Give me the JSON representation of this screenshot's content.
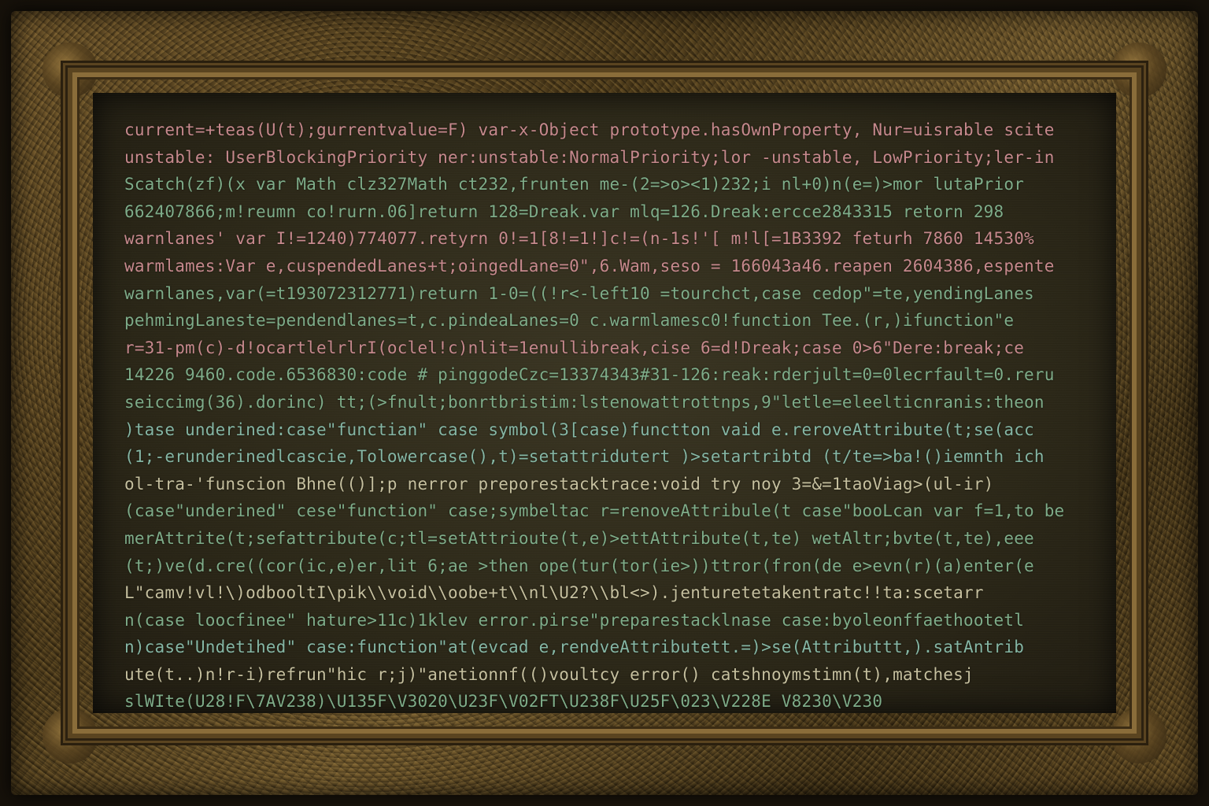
{
  "painting": {
    "lines": [
      {
        "text": "current=+teas(U(t);gurrentvalue=F) var-x-Object prototype.hasOwnProperty, Nur=uisrable scite",
        "color": "pink"
      },
      {
        "text": "unstable: UserBlockingPriority ner:unstable:NormalPriority;lor -unstable, LowPriority;ler-in",
        "color": "pink"
      },
      {
        "text": "Scatch(zf)(x var Math clz327Math ct232,frunten me-(2=>o><1)232;i nl+0)n(e=)>mor lutaPrior",
        "color": "green"
      },
      {
        "text": "662407866;m!reumn co!rurn.06]return 128=Dreak.var mlq=126.Dreak:ercce2843315 retorn 298",
        "color": "green"
      },
      {
        "text": "warnlanes' var I!=1240)774077.retyrn 0!=1[8!=1!]c!=(n-1s!'[ m!l[=1B3392 feturh 7860 14530%",
        "color": "pink"
      },
      {
        "text": "warmlames:Var e,cuspendedLanes+t;oingedLane=0\",6.Wam,seso = 166043a46.reapen 2604386,espente",
        "color": "pink"
      },
      {
        "text": "warnlanes,var(=t193072312771)return 1-0=((!r<-left10 =tourchct,case cedop\"=te,yendingLanes",
        "color": "green"
      },
      {
        "text": "pehmingLaneste=pendendlanes=t,c.pindeaLanes=0 c.warmlamesc0!function Tee.(r,)ifunction\"e",
        "color": "green"
      },
      {
        "text": "r=31-pm(c)-d!ocartlelrlrI(oclel!c)nlit=1enullibreak,cise 6=d!Dreak;case 0>6\"Dere:break;ce",
        "color": "pink"
      },
      {
        "text": "14226 9460.code.6536830:code # pinggodeCzc=13374343#31-126:reak:rderjult=0=0lecrfault=0.reru",
        "color": "green"
      },
      {
        "text": "seiccimg(36).dorinc) tt;(>fnult;bonrtbristim:lstenowattrottnps,9\"letle=eleelticnranis:theon",
        "color": "green"
      },
      {
        "text": ")tase underined:case\"functian\" case symbol(3[case)functton vaid e.reroveAttribute(t;se(acc",
        "color": "teal"
      },
      {
        "text": "(1;-erunderinedlcascie,Tolowercase(),t)=setattridutert )>setartribtd (t/te=>ba!()iemnth ich",
        "color": "teal"
      },
      {
        "text": "ol-tra-'funscion Bhne(()];p nerror preporestacktrace:void try noy 3=&=1taoViag>(ul-ir)",
        "color": "cream"
      },
      {
        "text": "(case\"underined\" cese\"function\" case;symbeltac r=renoveAttribule(t case\"booLcan var f=1,to be",
        "color": "green"
      },
      {
        "text": "merAttrite(t;sefattribute(c;tl=setAttrioute(t,e)>ettAttribute(t,te) wetAltr;bvte(t,te),eee",
        "color": "green"
      },
      {
        "text": "(t;)ve(d.cre((cor(ic,e)er,lit 6;ae >then ope(tur(tor(ie>))ttror(fron(de e>evn(r)(a)enter(e",
        "color": "green"
      },
      {
        "text": "L\"camv!vl!\\)odbooltI\\pik\\\\void\\\\oobe+t\\\\nl\\U2?\\\\bl<>).jenturetetakentratc!!ta:scetarr",
        "color": "cream"
      },
      {
        "text": "n(case loocfinee\" hature>11c)1klev error.pirse\"preparestacklnase case:byoleonffaethootetl",
        "color": "green"
      },
      {
        "text": "n)case\"Undetihed\" case:function\"at(evcad e,rendveAttributett.=)>se(Attributtt,).satAntrib",
        "color": "teal"
      },
      {
        "text": "ute(t..)n!r-i)refrun\"hic r;j)\"anetionnf(()voultcy error() catshnoymstimn(t),matchesj",
        "color": "cream"
      },
      {
        "text": "slWIte(U28!F\\7AV238)\\U135F\\V3020\\U23F\\V02FT\\U238F\\U25F\\023\\V228E V8230\\V230",
        "color": "green"
      }
    ]
  }
}
